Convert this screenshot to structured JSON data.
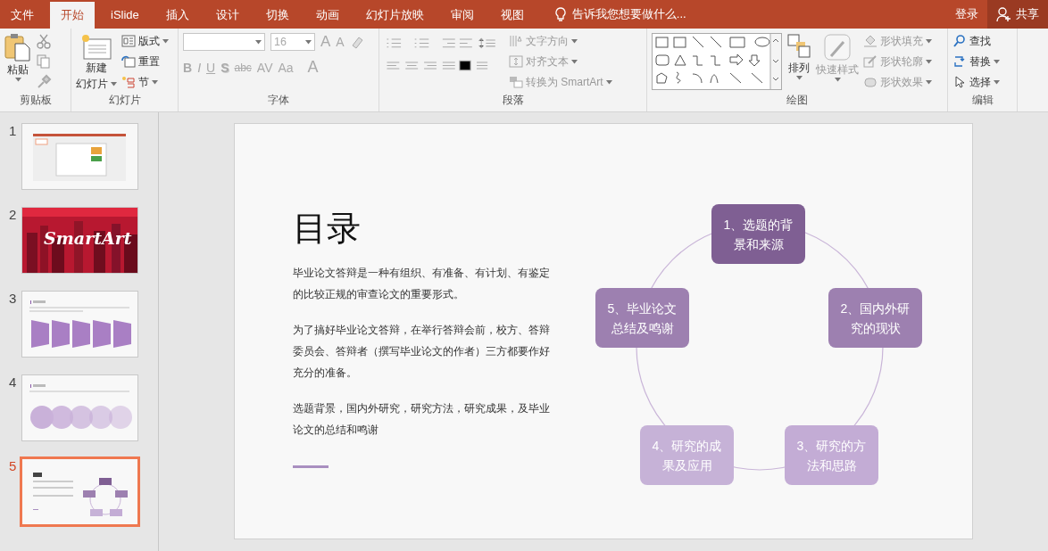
{
  "menu_tabs": [
    {
      "label": "文件",
      "selected": false
    },
    {
      "label": "开始",
      "selected": true
    },
    {
      "label": "iSlide",
      "selected": false
    },
    {
      "label": "插入",
      "selected": false
    },
    {
      "label": "设计",
      "selected": false
    },
    {
      "label": "切换",
      "selected": false
    },
    {
      "label": "动画",
      "selected": false
    },
    {
      "label": "幻灯片放映",
      "selected": false
    },
    {
      "label": "审阅",
      "selected": false
    },
    {
      "label": "视图",
      "selected": false
    }
  ],
  "tell_me": {
    "placeholder": "告诉我您想要做什么..."
  },
  "sign_in": "登录",
  "share": "共享",
  "ribbon": {
    "clipboard": {
      "paste": "粘贴",
      "label": "剪贴板"
    },
    "slides": {
      "new_slide": "新建",
      "new_slide_2": "幻灯片",
      "layout": "版式",
      "reset": "重置",
      "section": "节",
      "label": "幻灯片"
    },
    "font": {
      "size": "16",
      "grow": "A",
      "shrink": "A",
      "format_buttons": [
        "B",
        "I",
        "U",
        "S",
        "abc",
        "AV",
        "Aa",
        "A"
      ],
      "label": "字体"
    },
    "paragraph": {
      "text_direction": "文字方向",
      "align_text": "对齐文本",
      "convert": "转换为 SmartArt",
      "label": "段落"
    },
    "drawing": {
      "arrange": "排列",
      "quick_styles": "快速样式",
      "fill": "形状填充",
      "outline": "形状轮廓",
      "effects": "形状效果",
      "label": "绘图"
    },
    "editing": {
      "find": "查找",
      "replace": "替换",
      "select": "选择",
      "label": "编辑"
    }
  },
  "slides": [
    {
      "number": "1",
      "kind": "screenshot",
      "selected": false
    },
    {
      "number": "2",
      "title": "SmartArt",
      "selected": false
    },
    {
      "number": "3",
      "kind": "process",
      "selected": false
    },
    {
      "number": "4",
      "kind": "circles",
      "selected": false
    },
    {
      "number": "5",
      "kind": "toc",
      "selected": true
    }
  ],
  "slide": {
    "title": "目录",
    "paragraphs": [
      "毕业论文答辩是一种有组织、有准备、有计划、有鉴定的比较正规的审查论文的重要形式。",
      "为了搞好毕业论文答辩，在举行答辩会前，校方、答辩委员会、答辩者（撰写毕业论文的作者）三方都要作好充分的准备。",
      "选题背景，国内外研究，研究方法，研究成果，及毕业论文的总结和鸣谢"
    ],
    "cycle": [
      {
        "text": "1、选题的背景和来源",
        "color": "#7f5f93"
      },
      {
        "text": "5、毕业论文总结及鸣谢",
        "color": "#9d80b0"
      },
      {
        "text": "2、国内外研究的现状",
        "color": "#9d80b0"
      },
      {
        "text": "4、研究的成果及应用",
        "color": "#c6b2d7"
      },
      {
        "text": "3、研究的方法和思路",
        "color": "#c3acd5"
      }
    ]
  }
}
